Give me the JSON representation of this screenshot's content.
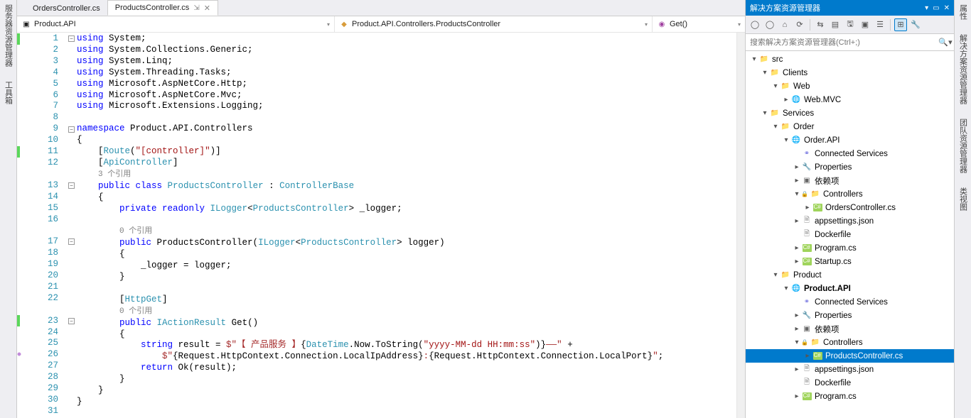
{
  "side_rails": {
    "left": [
      "服务器资源管理器",
      "工具箱"
    ],
    "right": [
      "属性",
      "解决方案资源管理器",
      "团队资源管理器",
      "类视图"
    ]
  },
  "tabs": [
    {
      "label": "OrdersController.cs",
      "active": false
    },
    {
      "label": "ProductsController.cs",
      "active": true
    }
  ],
  "nav_bar": {
    "left": "Product.API",
    "mid": "Product.API.Controllers.ProductsController",
    "right": "Get()"
  },
  "line_numbers": [
    "1",
    "2",
    "3",
    "4",
    "5",
    "6",
    "7",
    "8",
    "9",
    "10",
    "11",
    "12",
    "",
    "13",
    "14",
    "15",
    "16",
    "",
    "17",
    "18",
    "19",
    "20",
    "21",
    "22",
    "",
    "23",
    "24",
    "25",
    "26",
    "27",
    "28",
    "29",
    "30",
    "31"
  ],
  "code_lines": [
    {
      "indent": 0,
      "tok": [
        {
          "t": "using ",
          "c": "kw"
        },
        {
          "t": "System;"
        }
      ]
    },
    {
      "indent": 0,
      "tok": [
        {
          "t": "using ",
          "c": "kw"
        },
        {
          "t": "System.Collections.Generic;"
        }
      ]
    },
    {
      "indent": 0,
      "tok": [
        {
          "t": "using ",
          "c": "kw"
        },
        {
          "t": "System.Linq;"
        }
      ]
    },
    {
      "indent": 0,
      "tok": [
        {
          "t": "using ",
          "c": "kw"
        },
        {
          "t": "System.Threading.Tasks;"
        }
      ]
    },
    {
      "indent": 0,
      "tok": [
        {
          "t": "using ",
          "c": "kw"
        },
        {
          "t": "Microsoft.AspNetCore.Http;"
        }
      ]
    },
    {
      "indent": 0,
      "tok": [
        {
          "t": "using ",
          "c": "kw"
        },
        {
          "t": "Microsoft.AspNetCore.Mvc;"
        }
      ]
    },
    {
      "indent": 0,
      "tok": [
        {
          "t": "using ",
          "c": "kw"
        },
        {
          "t": "Microsoft.Extensions.Logging;"
        }
      ]
    },
    {
      "indent": 0,
      "tok": [
        {
          "t": ""
        }
      ]
    },
    {
      "indent": 0,
      "tok": [
        {
          "t": "namespace ",
          "c": "kw"
        },
        {
          "t": "Product.API.Controllers"
        }
      ]
    },
    {
      "indent": 0,
      "tok": [
        {
          "t": "{"
        }
      ]
    },
    {
      "indent": 1,
      "tok": [
        {
          "t": "["
        },
        {
          "t": "Route",
          "c": "type"
        },
        {
          "t": "("
        },
        {
          "t": "\"[controller]\"",
          "c": "str"
        },
        {
          "t": ")]"
        }
      ]
    },
    {
      "indent": 1,
      "tok": [
        {
          "t": "["
        },
        {
          "t": "ApiController",
          "c": "type"
        },
        {
          "t": "]"
        }
      ]
    },
    {
      "indent": 1,
      "tok": [
        {
          "t": "3 个引用",
          "c": "dim"
        }
      ]
    },
    {
      "indent": 1,
      "tok": [
        {
          "t": "public class ",
          "c": "kw"
        },
        {
          "t": "ProductsController",
          "c": "type"
        },
        {
          "t": " : "
        },
        {
          "t": "ControllerBase",
          "c": "type"
        }
      ]
    },
    {
      "indent": 1,
      "tok": [
        {
          "t": "{"
        }
      ]
    },
    {
      "indent": 2,
      "tok": [
        {
          "t": "private readonly ",
          "c": "kw"
        },
        {
          "t": "ILogger",
          "c": "type"
        },
        {
          "t": "<"
        },
        {
          "t": "ProductsController",
          "c": "type"
        },
        {
          "t": "> _logger;"
        }
      ]
    },
    {
      "indent": 0,
      "tok": [
        {
          "t": ""
        }
      ]
    },
    {
      "indent": 2,
      "tok": [
        {
          "t": "0 个引用",
          "c": "dim"
        }
      ]
    },
    {
      "indent": 2,
      "tok": [
        {
          "t": "public ",
          "c": "kw"
        },
        {
          "t": "ProductsController("
        },
        {
          "t": "ILogger",
          "c": "type"
        },
        {
          "t": "<"
        },
        {
          "t": "ProductsController",
          "c": "type"
        },
        {
          "t": "> logger)"
        }
      ]
    },
    {
      "indent": 2,
      "tok": [
        {
          "t": "{"
        }
      ]
    },
    {
      "indent": 3,
      "tok": [
        {
          "t": "_logger = logger;"
        }
      ]
    },
    {
      "indent": 2,
      "tok": [
        {
          "t": "}"
        }
      ]
    },
    {
      "indent": 0,
      "tok": [
        {
          "t": ""
        }
      ]
    },
    {
      "indent": 2,
      "tok": [
        {
          "t": "["
        },
        {
          "t": "HttpGet",
          "c": "type"
        },
        {
          "t": "]"
        }
      ]
    },
    {
      "indent": 2,
      "tok": [
        {
          "t": "0 个引用",
          "c": "dim"
        }
      ]
    },
    {
      "indent": 2,
      "tok": [
        {
          "t": "public ",
          "c": "kw"
        },
        {
          "t": "IActionResult",
          "c": "type"
        },
        {
          "t": " Get()"
        }
      ]
    },
    {
      "indent": 2,
      "tok": [
        {
          "t": "{"
        }
      ]
    },
    {
      "indent": 3,
      "tok": [
        {
          "t": "string ",
          "c": "kw"
        },
        {
          "t": "result = "
        },
        {
          "t": "$\"【 产品服务 】",
          "c": "brstr"
        },
        {
          "t": "{"
        },
        {
          "t": "DateTime",
          "c": "type"
        },
        {
          "t": ".Now.ToString("
        },
        {
          "t": "\"yyyy-MM-dd HH:mm:ss\"",
          "c": "str"
        },
        {
          "t": ")}"
        },
        {
          "t": "——\"",
          "c": "brstr"
        },
        {
          "t": " +"
        }
      ]
    },
    {
      "indent": 4,
      "tok": [
        {
          "t": "$\"",
          "c": "brstr"
        },
        {
          "t": "{Request.HttpContext.Connection.LocalIpAddress}"
        },
        {
          "t": ":",
          "c": "brstr"
        },
        {
          "t": "{Request.HttpContext.Connection.LocalPort}"
        },
        {
          "t": "\"",
          "c": "brstr"
        },
        {
          "t": ";"
        }
      ]
    },
    {
      "indent": 3,
      "tok": [
        {
          "t": "return ",
          "c": "kw"
        },
        {
          "t": "Ok(result);"
        }
      ]
    },
    {
      "indent": 2,
      "tok": [
        {
          "t": "}"
        }
      ]
    },
    {
      "indent": 1,
      "tok": [
        {
          "t": "}"
        }
      ]
    },
    {
      "indent": 0,
      "tok": [
        {
          "t": "}"
        }
      ]
    },
    {
      "indent": 0,
      "tok": [
        {
          "t": ""
        }
      ]
    }
  ],
  "gutter_marks": [
    "green",
    "",
    "",
    "",
    "",
    "",
    "",
    "",
    "",
    "",
    "green",
    "",
    "",
    "",
    "",
    "",
    "",
    "",
    "",
    "",
    "",
    "",
    "",
    "",
    "",
    "green",
    "",
    "",
    "mod",
    "",
    "",
    "",
    "",
    ""
  ],
  "fold_marks": {
    "0": "-",
    "8": "-",
    "13": "-",
    "18": "-",
    "25": "-"
  },
  "solution_explorer": {
    "title": "解决方案资源管理器",
    "search_placeholder": "搜索解决方案资源管理器(Ctrl+;)",
    "toolbar_icons": [
      "back",
      "fwd",
      "home",
      "refresh",
      "sep",
      "sync",
      "stack",
      "save",
      "prop",
      "all",
      "sep",
      "tree",
      "wrench"
    ],
    "tree": [
      {
        "d": 0,
        "exp": "▾",
        "icon": "folder",
        "label": "src"
      },
      {
        "d": 1,
        "exp": "▾",
        "icon": "folder",
        "label": "Clients"
      },
      {
        "d": 2,
        "exp": "▾",
        "icon": "folder",
        "label": "Web"
      },
      {
        "d": 3,
        "exp": "▸",
        "icon": "web",
        "label": "Web.MVC"
      },
      {
        "d": 1,
        "exp": "▾",
        "icon": "folder",
        "label": "Services"
      },
      {
        "d": 2,
        "exp": "▾",
        "icon": "folder",
        "label": "Order"
      },
      {
        "d": 3,
        "exp": "▾",
        "icon": "web",
        "label": "Order.API"
      },
      {
        "d": 4,
        "exp": "",
        "icon": "svc",
        "label": "Connected Services"
      },
      {
        "d": 4,
        "exp": "▸",
        "icon": "prop",
        "label": "Properties"
      },
      {
        "d": 4,
        "exp": "▸",
        "icon": "dep",
        "label": "依赖项"
      },
      {
        "d": 4,
        "exp": "▾",
        "icon": "folder",
        "label": "Controllers",
        "lock": true
      },
      {
        "d": 5,
        "exp": "▸",
        "icon": "cs",
        "label": "OrdersController.cs"
      },
      {
        "d": 4,
        "exp": "▸",
        "icon": "file",
        "label": "appsettings.json"
      },
      {
        "d": 4,
        "exp": "",
        "icon": "file",
        "label": "Dockerfile"
      },
      {
        "d": 4,
        "exp": "▸",
        "icon": "cs",
        "label": "Program.cs"
      },
      {
        "d": 4,
        "exp": "▸",
        "icon": "cs",
        "label": "Startup.cs"
      },
      {
        "d": 2,
        "exp": "▾",
        "icon": "folder",
        "label": "Product"
      },
      {
        "d": 3,
        "exp": "▾",
        "icon": "web",
        "label": "Product.API",
        "bold": true
      },
      {
        "d": 4,
        "exp": "",
        "icon": "svc",
        "label": "Connected Services"
      },
      {
        "d": 4,
        "exp": "▸",
        "icon": "prop",
        "label": "Properties"
      },
      {
        "d": 4,
        "exp": "▸",
        "icon": "dep",
        "label": "依赖项"
      },
      {
        "d": 4,
        "exp": "▾",
        "icon": "folder",
        "label": "Controllers",
        "lock": true
      },
      {
        "d": 5,
        "exp": "▸",
        "icon": "cs",
        "label": "ProductsController.cs",
        "selected": true
      },
      {
        "d": 4,
        "exp": "▸",
        "icon": "file",
        "label": "appsettings.json"
      },
      {
        "d": 4,
        "exp": "",
        "icon": "file",
        "label": "Dockerfile"
      },
      {
        "d": 4,
        "exp": "▸",
        "icon": "cs",
        "label": "Program.cs"
      }
    ]
  }
}
